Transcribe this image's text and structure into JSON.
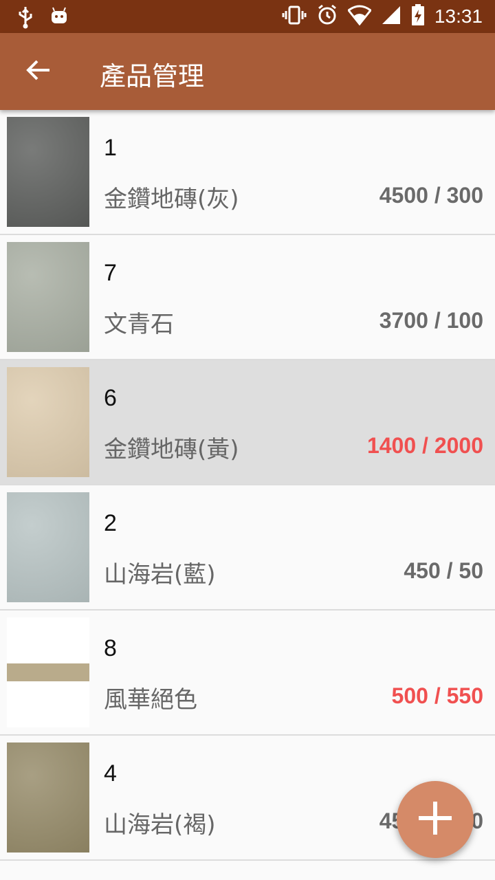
{
  "status_bar": {
    "time": "13:31",
    "icons": [
      "usb-icon",
      "android-icon",
      "vibrate-icon",
      "alarm-icon",
      "wifi-icon",
      "signal-icon",
      "battery-charging-icon"
    ]
  },
  "app_bar": {
    "title": "產品管理",
    "back_icon": "arrow-left-icon"
  },
  "products": [
    {
      "id": "1",
      "name": "金鑽地磚(灰)",
      "qty": "4500 / 300",
      "alert": false,
      "selected": false,
      "swatch": "#5c5e5c"
    },
    {
      "id": "7",
      "name": "文青石",
      "qty": "3700 / 100",
      "alert": false,
      "selected": false,
      "swatch": "#a8aea2"
    },
    {
      "id": "6",
      "name": "金鑽地磚(黃)",
      "qty": "1400 / 2000",
      "alert": true,
      "selected": true,
      "swatch": "#ddcbad"
    },
    {
      "id": "2",
      "name": "山海岩(藍)",
      "qty": "450 / 50",
      "alert": false,
      "selected": false,
      "swatch": "#b7c3c3"
    },
    {
      "id": "8",
      "name": "風華絕色",
      "qty": "500 / 550",
      "alert": true,
      "selected": false,
      "swatch": "#b9ab8b"
    },
    {
      "id": "4",
      "name": "山海岩(褐)",
      "qty": "4500 / 300",
      "alert": false,
      "selected": false,
      "swatch": "#958a68"
    }
  ],
  "fab": {
    "icon": "plus-icon"
  },
  "colors": {
    "status_bar": "#7a3312",
    "app_bar": "#a85c38",
    "fab": "#d58a68",
    "alert_text": "#f05050",
    "normal_qty_text": "#6a6a6a"
  }
}
